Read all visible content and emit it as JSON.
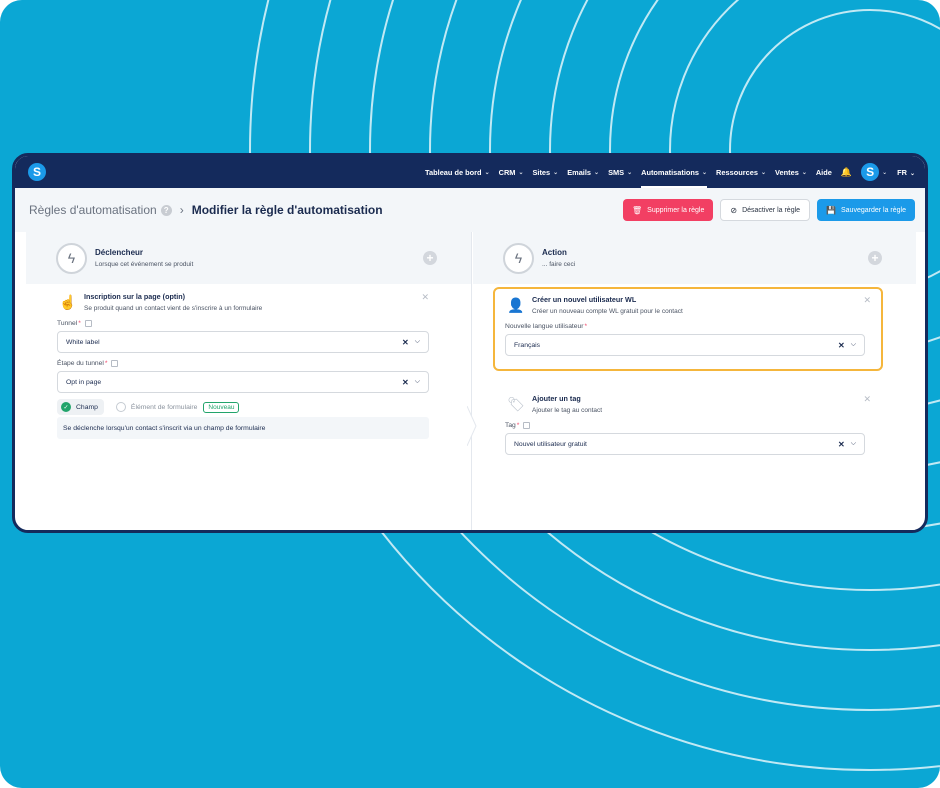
{
  "nav": {
    "logo": "S",
    "items": [
      {
        "label": "Tableau de bord",
        "chevron": true,
        "active": false
      },
      {
        "label": "CRM",
        "chevron": true,
        "active": false
      },
      {
        "label": "Sites",
        "chevron": true,
        "active": false
      },
      {
        "label": "Emails",
        "chevron": true,
        "active": false
      },
      {
        "label": "SMS",
        "chevron": true,
        "active": false
      },
      {
        "label": "Automatisations",
        "chevron": true,
        "active": true
      },
      {
        "label": "Ressources",
        "chevron": true,
        "active": false
      },
      {
        "label": "Ventes",
        "chevron": true,
        "active": false
      },
      {
        "label": "Aide",
        "chevron": false,
        "active": false
      }
    ],
    "avatar": "S",
    "lang": "FR"
  },
  "header": {
    "breadcrumb": "Règles d'automatisation",
    "help": "?",
    "title": "Modifier la règle d'automatisation",
    "delete_label": "Supprimer la règle",
    "disable_label": "Désactiver la règle",
    "save_label": "Sauvegarder la règle"
  },
  "trigger": {
    "title": "Déclencheur",
    "subtitle": "Lorsque cet événement se produit",
    "card": {
      "title": "Inscription sur la page (optin)",
      "subtitle": "Se produit quand un contact vient de s'inscrire à un formulaire",
      "tunnel_label": "Tunnel",
      "tunnel_value": "White label",
      "step_label": "Étape du tunnel",
      "step_value": "Opt in page",
      "radio_selected": "Champ",
      "radio_other": "Élément de formulaire",
      "badge": "Nouveau",
      "note": "Se déclenche lorsqu'un contact s'inscrit via un champ de formulaire"
    }
  },
  "action": {
    "title": "Action",
    "subtitle": "... faire ceci",
    "card1": {
      "title": "Créer un nouvel utilisateur WL",
      "subtitle": "Créer un nouveau compte WL gratuit pour le contact",
      "field_label": "Nouvelle langue utilisateur",
      "field_value": "Français"
    },
    "card2": {
      "title": "Ajouter un tag",
      "subtitle": "Ajouter le tag au contact",
      "field_label": "Tag",
      "field_value": "Nouvel utilisateur gratuit"
    }
  },
  "colors": {
    "nav_bg": "#142a5c",
    "primary": "#1b9ae9",
    "danger": "#f23f63",
    "highlight": "#f5b63c",
    "success": "#22a46b",
    "bg": "#0ba7d4"
  }
}
